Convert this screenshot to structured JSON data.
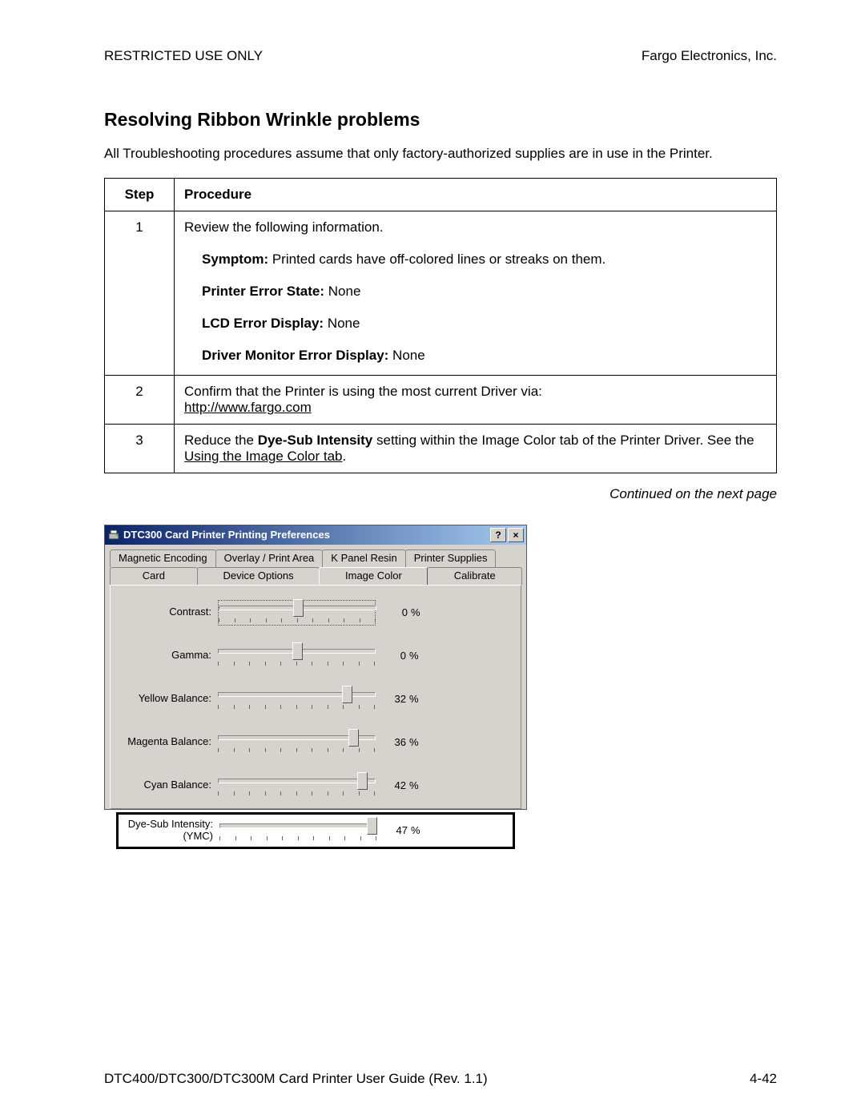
{
  "header": {
    "left": "RESTRICTED USE ONLY",
    "right": "Fargo Electronics, Inc."
  },
  "title": "Resolving Ribbon Wrinkle problems",
  "intro": "All Troubleshooting procedures assume that only factory-authorized supplies are in use in the Printer.",
  "table": {
    "headers": {
      "step": "Step",
      "proc": "Procedure"
    },
    "rows": [
      {
        "num": "1",
        "lines": {
          "open": "Review the following information.",
          "symptom_label": "Symptom:",
          "symptom_text": "  Printed cards have off-colored lines or streaks on them.",
          "pes_label": "Printer Error State:",
          "pes_text": "  None",
          "led_label": "LCD Error Display:",
          "led_text": "  None",
          "dme_label": "Driver Monitor Error Display:",
          "dme_text": "  None"
        }
      },
      {
        "num": "2",
        "text_a": "Confirm that the Printer is using the most current Driver via: ",
        "link": "http://www.fargo.com"
      },
      {
        "num": "3",
        "text_a": "Reduce the ",
        "bold": "Dye-Sub Intensity",
        "text_b": " setting within the Image Color tab of the Printer Driver. See the ",
        "link": "Using the Image Color tab",
        "text_c": "."
      }
    ]
  },
  "continued": "Continued on the next page",
  "dialog": {
    "title": "DTC300 Card Printer Printing Preferences",
    "help_char": "?",
    "close_char": "×",
    "tabs_row1": [
      "Magnetic Encoding",
      "Overlay / Print Area",
      "K Panel Resin",
      "Printer Supplies"
    ],
    "tabs_row2": [
      "Card",
      "Device Options",
      "Image Color",
      "Calibrate"
    ],
    "active_tab": "Image Color",
    "sliders": [
      {
        "label": "Contrast:",
        "value": "0",
        "unit": "%",
        "pos_pct": 50,
        "focus": true,
        "highlight": false
      },
      {
        "label": "Gamma:",
        "value": "0",
        "unit": "%",
        "pos_pct": 50,
        "focus": false,
        "highlight": false
      },
      {
        "label": "Yellow Balance:",
        "value": "32",
        "unit": "%",
        "pos_pct": 82,
        "focus": false,
        "highlight": false
      },
      {
        "label": "Magenta Balance:",
        "value": "36",
        "unit": "%",
        "pos_pct": 86,
        "focus": false,
        "highlight": false
      },
      {
        "label": "Cyan Balance:",
        "value": "42",
        "unit": "%",
        "pos_pct": 92,
        "focus": false,
        "highlight": false
      },
      {
        "label": "Dye-Sub Intensity:\n(YMC)",
        "value": "47",
        "unit": "%",
        "pos_pct": 97,
        "focus": false,
        "highlight": true
      }
    ]
  },
  "footer": {
    "left": "DTC400/DTC300/DTC300M Card Printer User Guide (Rev. 1.1)",
    "right": "4-42"
  }
}
